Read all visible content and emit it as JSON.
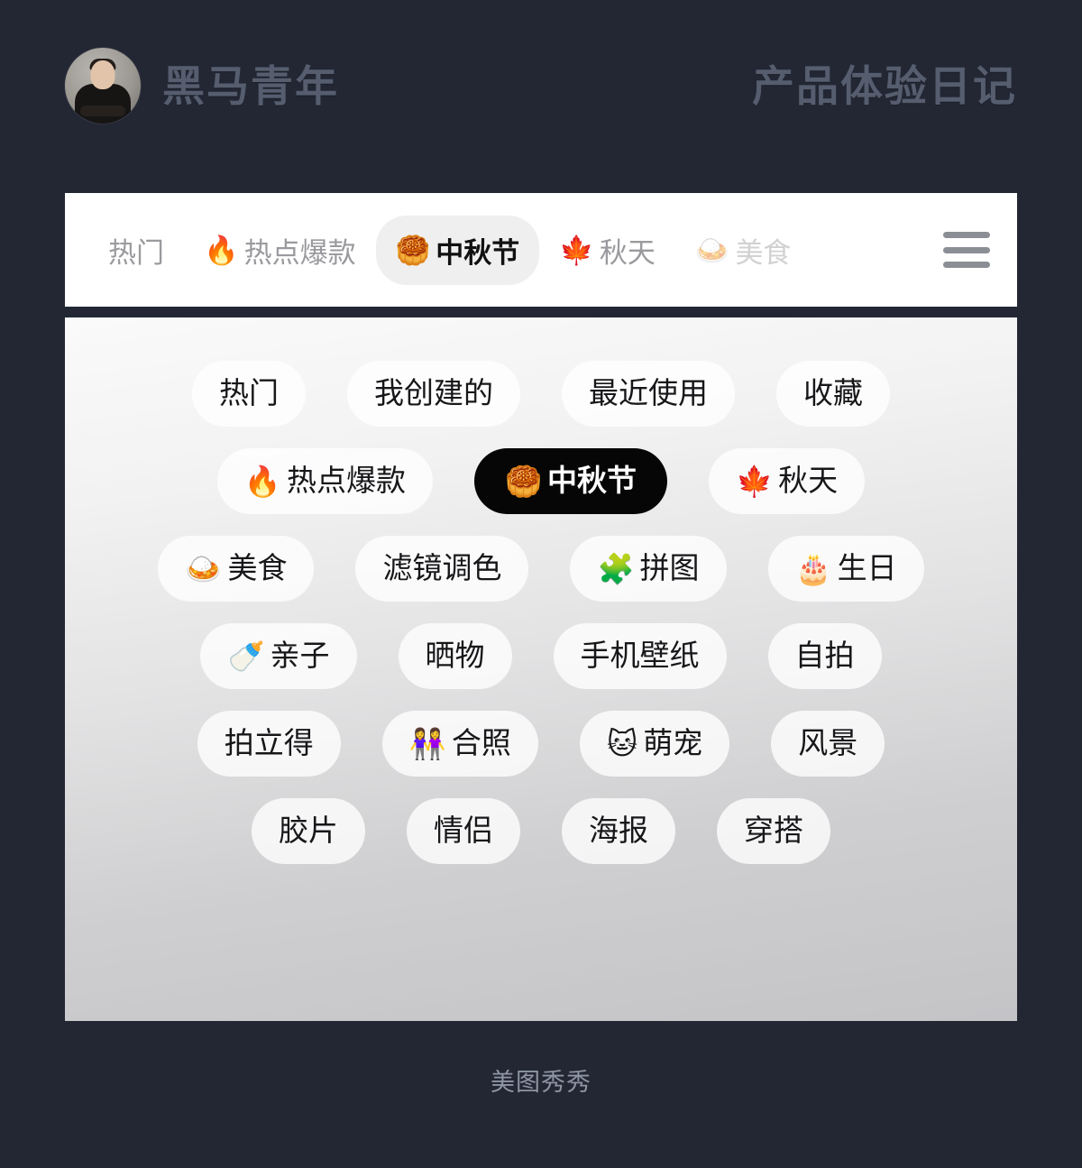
{
  "header": {
    "avatar_alt": "avatar",
    "brand_name": "黑马青年",
    "title": "产品体验日记"
  },
  "tabbar": {
    "menu_icon": "hamburger-menu-icon",
    "tabs": [
      {
        "emoji": "",
        "label": "热门",
        "selected": false,
        "faded": false
      },
      {
        "emoji": "🔥",
        "label": "热点爆款",
        "selected": false,
        "faded": false
      },
      {
        "emoji": "🥮",
        "label": "中秋节",
        "selected": true,
        "faded": false
      },
      {
        "emoji": "🍁",
        "label": "秋天",
        "selected": false,
        "faded": false
      },
      {
        "emoji": "🍛",
        "label": "美食",
        "selected": false,
        "faded": true
      }
    ]
  },
  "panel": {
    "rows": [
      [
        {
          "emoji": "",
          "label": "热门",
          "selected": false
        },
        {
          "emoji": "",
          "label": "我创建的",
          "selected": false
        },
        {
          "emoji": "",
          "label": "最近使用",
          "selected": false
        },
        {
          "emoji": "",
          "label": "收藏",
          "selected": false
        }
      ],
      [
        {
          "emoji": "🔥",
          "label": "热点爆款",
          "selected": false
        },
        {
          "emoji": "🥮",
          "label": "中秋节",
          "selected": true
        },
        {
          "emoji": "🍁",
          "label": "秋天",
          "selected": false
        }
      ],
      [
        {
          "emoji": "🍛",
          "label": "美食",
          "selected": false
        },
        {
          "emoji": "",
          "label": "滤镜调色",
          "selected": false
        },
        {
          "emoji": "🧩",
          "label": "拼图",
          "selected": false
        },
        {
          "emoji": "🎂",
          "label": "生日",
          "selected": false
        }
      ],
      [
        {
          "emoji": "🍼",
          "label": "亲子",
          "selected": false
        },
        {
          "emoji": "",
          "label": "晒物",
          "selected": false
        },
        {
          "emoji": "",
          "label": "手机壁纸",
          "selected": false
        },
        {
          "emoji": "",
          "label": "自拍",
          "selected": false
        }
      ],
      [
        {
          "emoji": "",
          "label": "拍立得",
          "selected": false
        },
        {
          "emoji": "👭",
          "label": "合照",
          "selected": false
        },
        {
          "emoji": "🐱",
          "label": "萌宠",
          "selected": false
        },
        {
          "emoji": "",
          "label": "风景",
          "selected": false
        }
      ],
      [
        {
          "emoji": "",
          "label": "胶片",
          "selected": false
        },
        {
          "emoji": "",
          "label": "情侣",
          "selected": false
        },
        {
          "emoji": "",
          "label": "海报",
          "selected": false
        },
        {
          "emoji": "",
          "label": "穿搭",
          "selected": false
        }
      ]
    ]
  },
  "footer": {
    "caption": "美图秀秀"
  },
  "colors": {
    "page_background": "#232734",
    "header_text": "#555d6e",
    "tabbar_background": "#ffffff",
    "tab_selected_background": "#efefef",
    "chip_background": "rgba(255,255,255,0.78)",
    "chip_selected_background": "#060606",
    "footer_text": "#8e95a3"
  }
}
